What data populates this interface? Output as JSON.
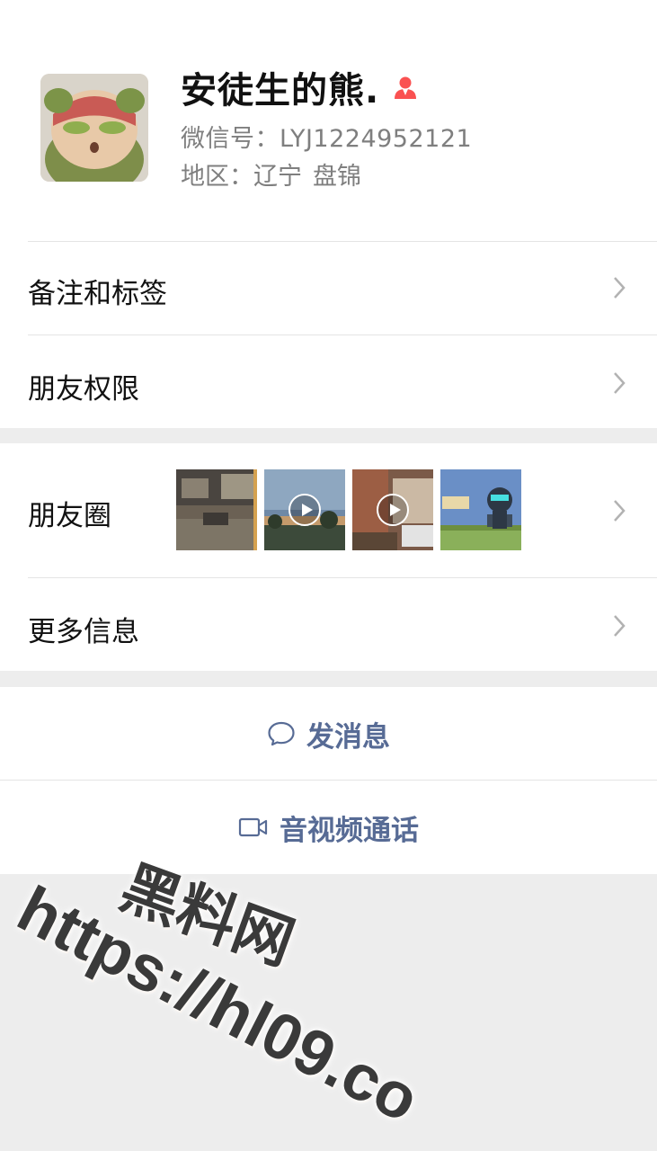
{
  "profile": {
    "name": "安徒生的熊.",
    "wechat_id": "微信号：LYJ1224952121",
    "region_label": "地区：",
    "region_province": "辽宁",
    "region_city": "盘锦",
    "gender_icon": "female-user-icon"
  },
  "menu": {
    "remarks_tags": "备注和标签",
    "friend_permissions": "朋友权限",
    "moments": "朋友圈",
    "more_info": "更多信息"
  },
  "actions": {
    "send_message": "发消息",
    "video_call": "音视频通话"
  },
  "colors": {
    "link": "#576b95",
    "gender_icon": "#fa5151",
    "background": "#ededed"
  },
  "watermark": {
    "line1": "黑料网",
    "line2": "https://hl09.co"
  }
}
